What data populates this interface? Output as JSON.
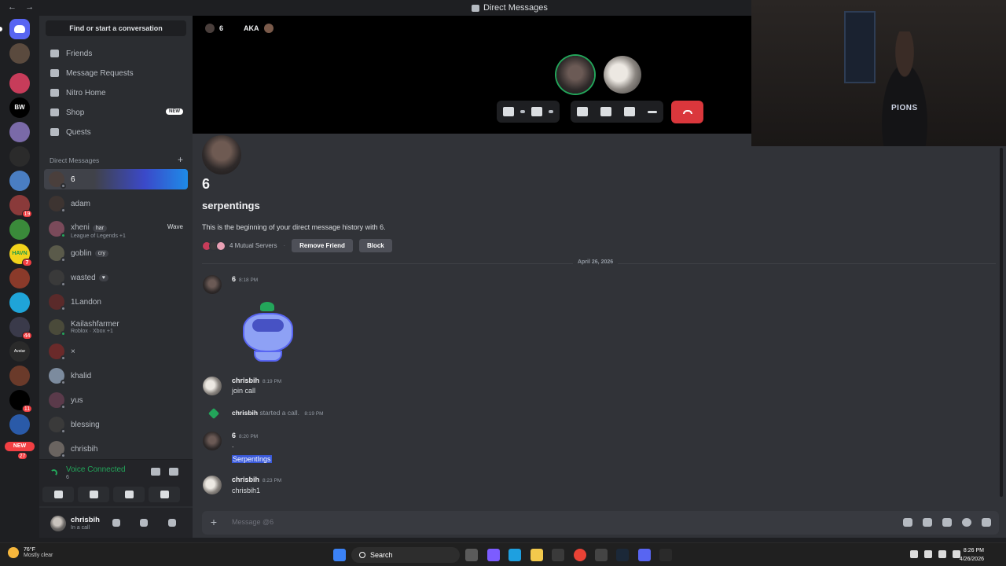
{
  "window": {
    "title": "Direct Messages",
    "nav": [
      "←",
      "→"
    ]
  },
  "rail": {
    "servers": [
      {
        "name": "home",
        "color": "#5865f2"
      },
      {
        "name": "server-1",
        "color": "#5a4a3e",
        "badge": ""
      },
      {
        "name": "server-2",
        "color": "#c73c5a"
      },
      {
        "name": "server-3",
        "color": "#000000",
        "label": "BW"
      },
      {
        "name": "server-4",
        "color": "#7a6aa8"
      },
      {
        "name": "server-5",
        "color": "#2b2b2b"
      },
      {
        "name": "server-6",
        "color": "#4a7ec2"
      },
      {
        "name": "server-7",
        "color": "#8a3a3a",
        "badge": "19"
      },
      {
        "name": "server-8",
        "color": "#3a8a3a"
      },
      {
        "name": "server-9",
        "color": "#1f9b4a",
        "label": "HAVN",
        "badge": "7"
      },
      {
        "name": "server-10",
        "color": "#8a3a2a"
      },
      {
        "name": "server-11",
        "color": "#1fa4d8"
      },
      {
        "name": "server-12",
        "color": "#3a3a4a",
        "badge": "44"
      },
      {
        "name": "server-13",
        "color": "#2a2a2a",
        "label": "Avatar"
      },
      {
        "name": "server-14",
        "color": "#6a3a2a"
      },
      {
        "name": "server-15",
        "color": "#000000",
        "badge": "11"
      },
      {
        "name": "server-16",
        "color": "#2a5aa8"
      }
    ],
    "new_label": "NEW",
    "new_badge": "27"
  },
  "sidebar": {
    "find_label": "Find or start a conversation",
    "nav": [
      {
        "label": "Friends",
        "icon": "friends-icon"
      },
      {
        "label": "Message Requests",
        "icon": "mail-icon"
      },
      {
        "label": "Nitro Home",
        "icon": "nitro-icon"
      },
      {
        "label": "Shop",
        "icon": "shop-icon",
        "tag": "NEW"
      },
      {
        "label": "Quests",
        "icon": "quests-icon"
      }
    ],
    "dm_header": "Direct Messages",
    "dm_add": "+",
    "dms": [
      {
        "name": "6",
        "active": true,
        "color": "#4a3f3c"
      },
      {
        "name": "adam",
        "color": "#3d3431"
      },
      {
        "name": "xheni",
        "pill": "har",
        "sub": "League of Legends +1",
        "action": "Wave",
        "color": "#7a4a5a"
      },
      {
        "name": "goblin",
        "pill": "cry",
        "color": "#5a5a4a"
      },
      {
        "name": "wasted",
        "pill": "♥",
        "color": "#3a3a3a"
      },
      {
        "name": "1Landon",
        "color": "#5a2a2a"
      },
      {
        "name": "Kailashfarmer",
        "sub": "Roblox · Xbox +1",
        "color": "#4a4a3a"
      },
      {
        "name": "×",
        "color": "#6a2a2a"
      },
      {
        "name": "khalid",
        "color": "#7c8b9e"
      },
      {
        "name": "yus",
        "color": "#5a3a4a"
      },
      {
        "name": "blessing",
        "color": "#3a3a3a"
      },
      {
        "name": "chrisbih",
        "color": "#6a6460"
      }
    ],
    "voice": {
      "status": "Voice Connected",
      "channel": "6"
    },
    "user": {
      "name": "chrisbih",
      "status": "In a call"
    }
  },
  "call": {
    "header_name": "6",
    "header_aka": "AKA"
  },
  "webcam": {
    "shirt_text": "PIONS"
  },
  "intro": {
    "display_name": "6",
    "username": "serpentings",
    "text": "This is the beginning of your direct message history with 6.",
    "mutual": "4 Mutual Servers",
    "remove_friend": "Remove Friend",
    "block": "Block"
  },
  "divider_date": "April 26, 2026",
  "messages": [
    {
      "author": "6",
      "time": "8:18 PM",
      "text": ""
    },
    {
      "author": "chrisbih",
      "time": "8:19 PM",
      "text": "join call"
    },
    {
      "system_author": "chrisbih",
      "system_text": "started a call.",
      "time": "8:19 PM"
    },
    {
      "author": "6",
      "time": "8:20 PM",
      "text": ".",
      "highlight": "SerpentIngs"
    },
    {
      "author": "chrisbih",
      "time": "8:23 PM",
      "text": "chrisbih1"
    }
  ],
  "composer": {
    "placeholder": "Message @6"
  },
  "taskbar": {
    "temp": "76°F",
    "weather": "Mostly clear",
    "search": "Search",
    "time": "8:26 PM",
    "date": "4/26/2026"
  },
  "colors": {
    "accent": "#5865f2",
    "online": "#23a55a",
    "danger": "#da373c"
  }
}
